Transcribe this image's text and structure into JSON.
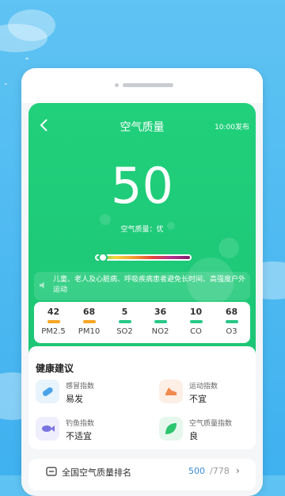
{
  "header": {
    "title": "空气质量",
    "published": "10:00发布"
  },
  "aqi": {
    "value": "50",
    "quality_text": "空气质量：优",
    "level_fraction": 0.05
  },
  "advice": "儿童、老人及心脏病、呼吸疾病患者避免长时间、高强度户外运动",
  "pollutants": [
    {
      "value": "42",
      "name": "PM2.5",
      "color": "#f5a623"
    },
    {
      "value": "68",
      "name": "PM10",
      "color": "#f5a623"
    },
    {
      "value": "5",
      "name": "SO2",
      "color": "#27c986"
    },
    {
      "value": "36",
      "name": "NO2",
      "color": "#27c986"
    },
    {
      "value": "10",
      "name": "CO",
      "color": "#27c986"
    },
    {
      "value": "68",
      "name": "O3",
      "color": "#27c986"
    }
  ],
  "health": {
    "title": "健康建议",
    "items": [
      {
        "name": "感冒指数",
        "level": "易发",
        "icon": "pill-icon"
      },
      {
        "name": "运动指数",
        "level": "不宜",
        "icon": "running-shoe-icon"
      },
      {
        "name": "钓鱼指数",
        "level": "不适宜",
        "icon": "fish-icon"
      },
      {
        "name": "空气质量指数",
        "level": "良",
        "icon": "leaf-icon"
      }
    ]
  },
  "ranking": {
    "label": "全国空气质量排名",
    "position": "500",
    "total": "/778"
  },
  "colors": {
    "green": "#1cc575",
    "sky": "#5fc3f3"
  }
}
